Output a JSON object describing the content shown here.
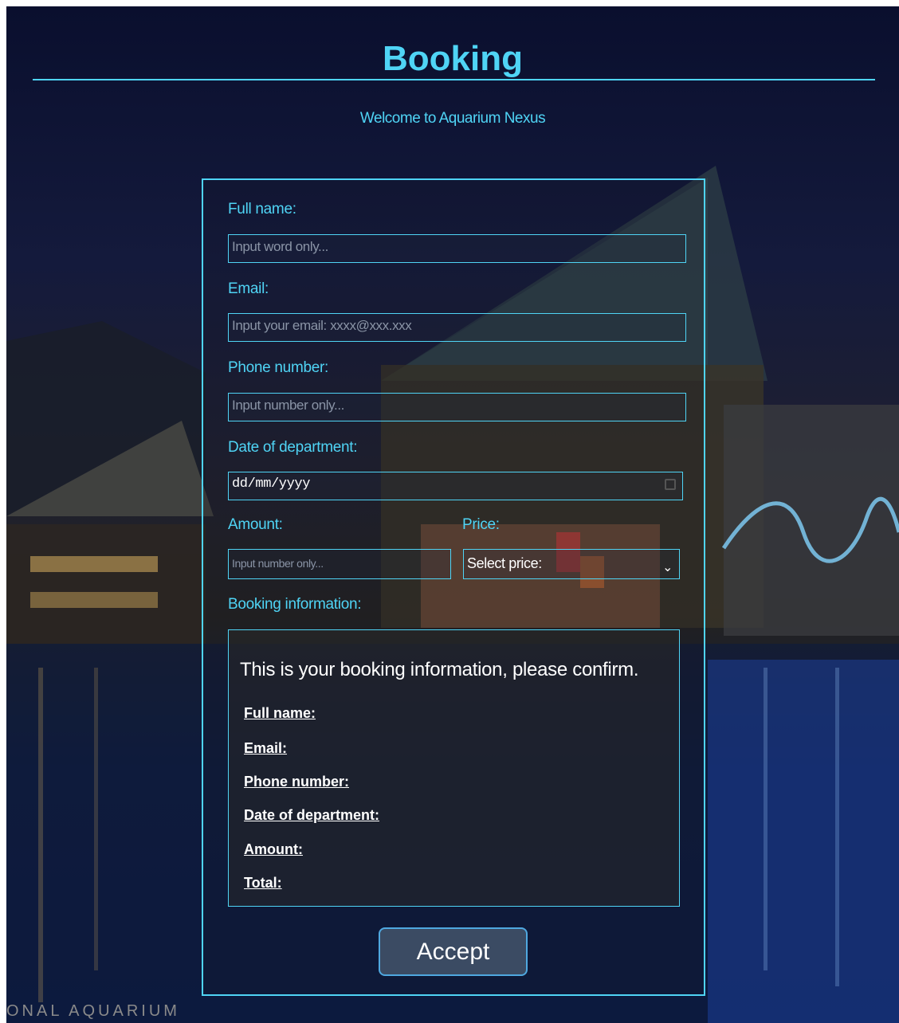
{
  "header": {
    "title": "Booking",
    "welcome": "Welcome to Aquarium Nexus"
  },
  "form": {
    "full_name": {
      "label": "Full name:",
      "placeholder": "Input word only..."
    },
    "email": {
      "label": "Email:",
      "placeholder": "Input your email: xxxx@xxx.xxx"
    },
    "phone": {
      "label": "Phone number:",
      "placeholder": "Input number only..."
    },
    "date": {
      "label": "Date of department:",
      "value": "dd/mm/yyyy"
    },
    "amount": {
      "label": "Amount:",
      "placeholder": "Input number only..."
    },
    "price": {
      "label": "Price:",
      "selected": "Select price:"
    }
  },
  "booking_info": {
    "label": "Booking information:",
    "heading": "This is your booking information, please confirm.",
    "rows": [
      "Full name:",
      "Email:",
      "Phone number:",
      "Date of department:",
      "Amount:",
      "Total:"
    ]
  },
  "accept_label": "Accept",
  "background_watermark": "ONAL AQUARIUM",
  "colors": {
    "accent": "#4fd4f5",
    "button_bg": "#3b4b63",
    "button_border": "#4fa8e0"
  }
}
